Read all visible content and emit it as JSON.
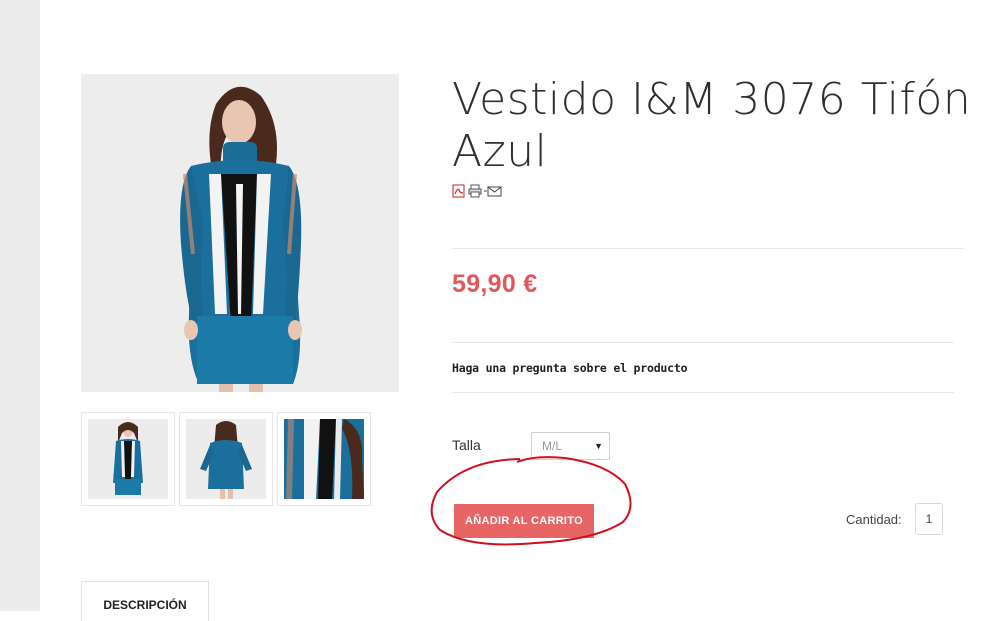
{
  "product": {
    "title": "Vestido I&M 3076 Tifón Azul",
    "price": "59,90 €",
    "ask_question": "Haga una pregunta sobre el producto",
    "size_label": "Talla",
    "size_selected": "M/L",
    "add_to_cart": "AÑADIR AL CARRITO",
    "quantity_label": "Cantidad:",
    "quantity_value": "1"
  },
  "toolbar_icons": [
    "pdf-icon",
    "print-icon",
    "email-icon"
  ],
  "tabs": [
    {
      "label": "DESCRIPCIÓN"
    }
  ],
  "colors": {
    "price": "#e0585c",
    "button": "#e86565",
    "annotation": "#d10f1f",
    "dress_blue": "#1b6f9c"
  }
}
